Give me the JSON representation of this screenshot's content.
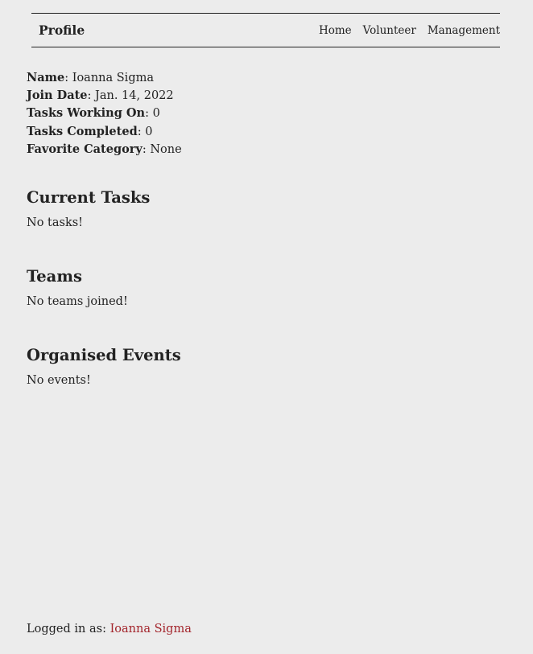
{
  "nav": {
    "brand": "Profile",
    "links": [
      "Home",
      "Volunteer",
      "Management"
    ]
  },
  "profile": {
    "name_label": "Name",
    "name_value": "Ioanna Sigma",
    "join_label": "Join Date",
    "join_value": "Jan. 14, 2022",
    "working_label": "Tasks Working On",
    "working_value": "0",
    "completed_label": "Tasks Completed",
    "completed_value": "0",
    "category_label": "Favorite Category",
    "category_value": "None"
  },
  "sections": {
    "tasks_title": "Current Tasks",
    "tasks_empty": "No tasks!",
    "teams_title": "Teams",
    "teams_empty": "No teams joined!",
    "events_title": "Organised Events",
    "events_empty": "No events!"
  },
  "footer": {
    "label": "Logged in as:",
    "user": "Ioanna Sigma",
    "link_color": "#a3252c"
  }
}
